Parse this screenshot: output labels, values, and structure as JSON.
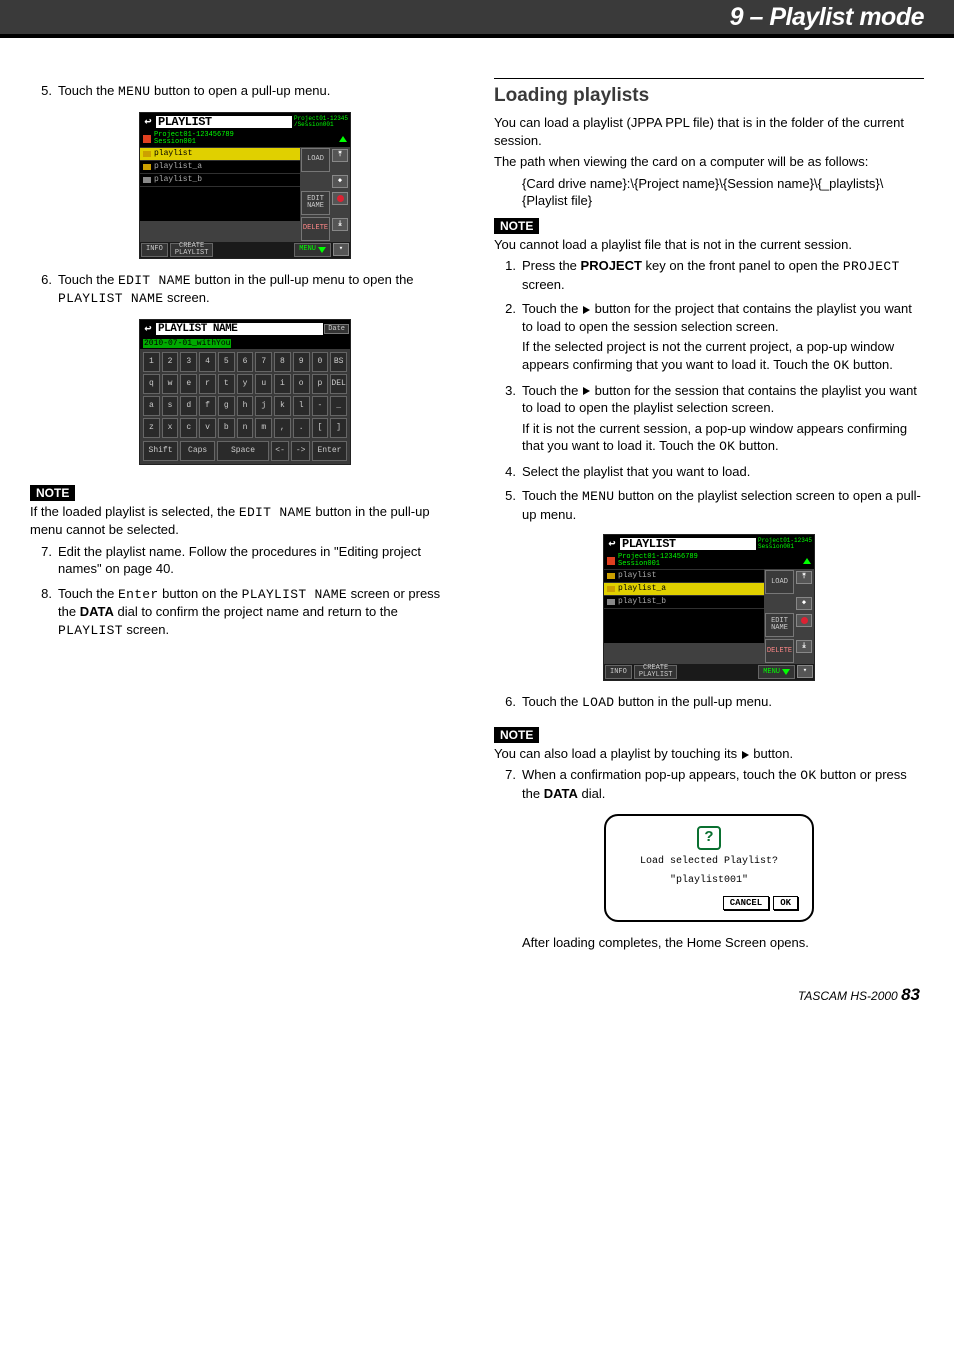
{
  "header": {
    "title": "9 – Playlist mode"
  },
  "left": {
    "step5": {
      "num": "5.",
      "text_a": "Touch the ",
      "mono": "MENU",
      "text_b": " button to open a pull-up menu."
    },
    "fig1": {
      "title": "PLAYLIST",
      "crumb1": "Project01-12345",
      "crumb2": "/Session001",
      "pathline1": "Project01-123456789",
      "pathline2": "Session001",
      "rows": [
        {
          "name": "playlist",
          "sel": true,
          "gray": false
        },
        {
          "name": "playlist_a",
          "sel": false,
          "gray": false
        },
        {
          "name": "playlist_b",
          "sel": false,
          "gray": true
        }
      ],
      "btn_load": "LOAD",
      "btn_editname_l1": "EDIT",
      "btn_editname_l2": "NAME",
      "btn_delete": "DELETE",
      "btn_menu": "MENU",
      "btn_info": "INFO",
      "btn_create_l1": "CREATE",
      "btn_create_l2": "PLAYLIST"
    },
    "step6": {
      "num": "6.",
      "text_a": "Touch the ",
      "mono1": "EDIT NAME",
      "text_b": " button in the pull-up menu to open the ",
      "mono2": "PLAYLIST NAME",
      "text_c": " screen."
    },
    "fig2": {
      "title": "PLAYLIST NAME",
      "date": "Date",
      "entry": "2010-07-01_withYou",
      "keys_rows": [
        [
          "1",
          "2",
          "3",
          "4",
          "5",
          "6",
          "7",
          "8",
          "9",
          "0",
          "BS"
        ],
        [
          "q",
          "w",
          "e",
          "r",
          "t",
          "y",
          "u",
          "i",
          "o",
          "p",
          "DEL"
        ],
        [
          "a",
          "s",
          "d",
          "f",
          "g",
          "h",
          "j",
          "k",
          "l",
          "-",
          "_"
        ],
        [
          "z",
          "x",
          "c",
          "v",
          "b",
          "n",
          "m",
          ",",
          ".",
          "[",
          "]"
        ]
      ],
      "bottom": {
        "shift": "Shift",
        "caps": "Caps",
        "space": "Space",
        "left": "<-",
        "right": "->",
        "enter": "Enter"
      }
    },
    "note1_label": "NOTE",
    "note1_a": "If the loaded playlist is selected, the ",
    "note1_mono": "EDIT NAME",
    "note1_b": " button in the pull-up menu cannot be selected.",
    "step7": {
      "num": "7.",
      "text": "Edit the playlist name. Follow the procedures in \"Editing project names\" on page 40."
    },
    "step8": {
      "num": "8.",
      "a": "Touch the ",
      "m1": "Enter",
      "b": " button on the ",
      "m2": "PLAYLIST NAME",
      "c": " screen or press the ",
      "bold": "DATA",
      "d": " dial to confirm the project name and return to the ",
      "m3": "PLAYLIST",
      "e": " screen."
    }
  },
  "right": {
    "heading": "Loading playlists",
    "p1": "You can load a playlist (JPPA PPL file) that is in the folder of the current session.",
    "p2": "The path when viewing the card on a computer will be as follows:",
    "path": "{Card drive name}:\\{Project name}\\{Session name}\\{_playlists}\\{Playlist file}",
    "note1_label": "NOTE",
    "note1": "You cannot load a playlist file that is not in the current session.",
    "s1": {
      "num": "1.",
      "a": "Press the ",
      "bold": "PROJECT",
      "b": " key on the front panel to open the ",
      "m": "PROJECT",
      "c": " screen."
    },
    "s2": {
      "num": "2.",
      "a": "Touch the ",
      "b": " button for the project that contains the playlist you want to load to open the session selection screen.",
      "p2a": "If the selected project is not the current project, a pop-up window appears confirming that you want to load it. Touch the ",
      "m": "OK",
      "p2b": " button."
    },
    "s3": {
      "num": "3.",
      "a": "Touch the ",
      "b": " button for the session that contains the playlist you want to load to open the playlist selection screen.",
      "p2a": "If it is not the current session, a pop-up window appears confirming that you want to load it. Touch the ",
      "m": "OK",
      "p2b": " button."
    },
    "s4": {
      "num": "4.",
      "a": "Select the playlist that you want to load."
    },
    "s5": {
      "num": "5.",
      "a": "Touch the ",
      "m": "MENU",
      "b": " button on the playlist selection screen to open a pull-up menu."
    },
    "fig3": {
      "title": "PLAYLIST",
      "crumb1": "Project01-12345",
      "crumb2": "Session001",
      "pathline1": "Project01-123456789",
      "pathline2": "Session001",
      "rows": [
        {
          "name": "playlist",
          "sel": false,
          "gray": false
        },
        {
          "name": "playlist_a",
          "sel": true,
          "gray": false
        },
        {
          "name": "playlist_b",
          "sel": false,
          "gray": true
        }
      ],
      "btn_load": "LOAD",
      "btn_editname_l1": "EDIT",
      "btn_editname_l2": "NAME",
      "btn_delete": "DELETE",
      "btn_menu": "MENU",
      "btn_info": "INFO",
      "btn_create_l1": "CREATE",
      "btn_create_l2": "PLAYLIST"
    },
    "s6": {
      "num": "6.",
      "a": "Touch the ",
      "m": "LOAD",
      "b": " button in the pull-up menu."
    },
    "note2_label": "NOTE",
    "note2a": "You can also load a playlist by touching its ",
    "note2b": " button.",
    "s7": {
      "num": "7.",
      "a": "When a confirmation pop-up appears, touch the ",
      "m": "OK",
      "b": " button or press the ",
      "bold": "DATA",
      "c": " dial."
    },
    "confirm": {
      "line1": "Load selected Playlist?",
      "line2": "\"playlist001\"",
      "cancel": "CANCEL",
      "ok": "OK"
    },
    "after": "After loading completes, the Home Screen opens."
  },
  "footer": {
    "brand": "TASCAM HS-2000",
    "page": "83"
  }
}
